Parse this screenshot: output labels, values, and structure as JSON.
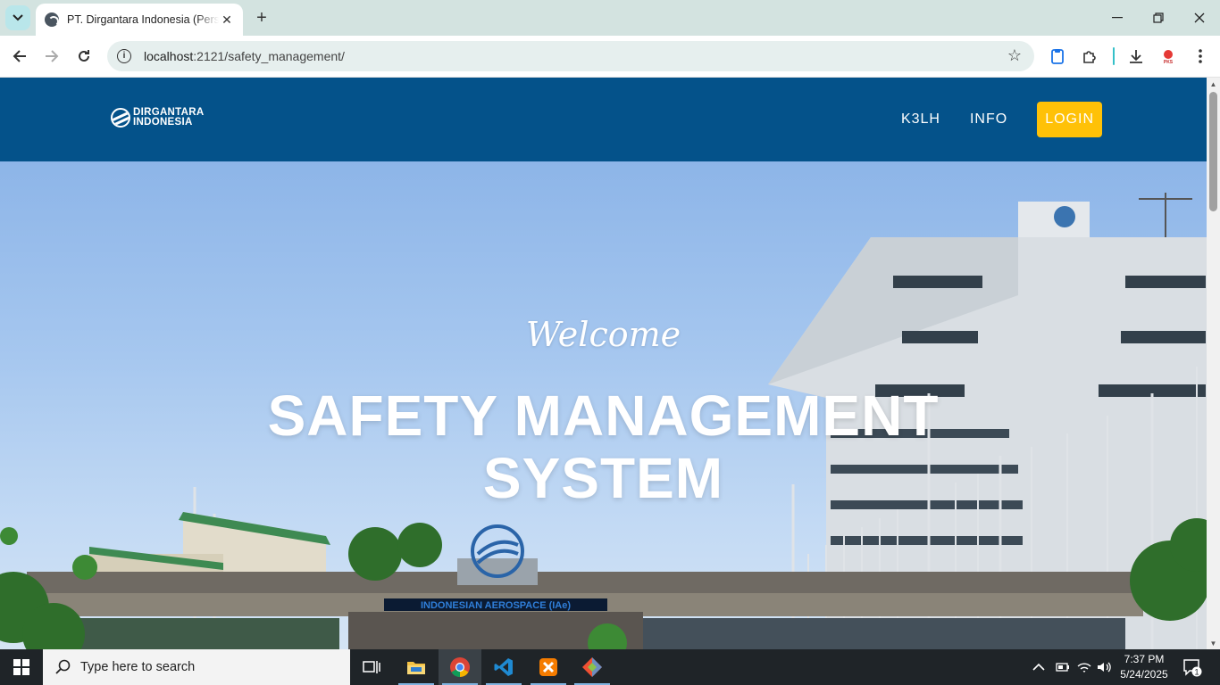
{
  "browser": {
    "tab_title": "PT. Dirgantara Indonesia (Persero)",
    "tab_close": "✕",
    "new_tab": "+",
    "url_host": "localhost",
    "url_path": ":2121/safety_management/",
    "accent": "#35c0c8"
  },
  "site": {
    "logo_line1": "DIRGANTARA",
    "logo_line2": "INDONESIA",
    "nav": {
      "k3lh": "K3LH",
      "info": "INFO",
      "login": "LOGIN"
    },
    "header_color": "#04528a",
    "login_color": "#ffc107"
  },
  "hero": {
    "welcome": "Welcome",
    "title_line1": "SAFETY MANAGEMENT",
    "title_line2": "SYSTEM",
    "building_sign": "INDONESIAN AEROSPACE (IAe)"
  },
  "taskbar": {
    "search_placeholder": "Type here to search",
    "time": "7:37 PM",
    "date": "5/24/2025",
    "notification_count": "1"
  }
}
